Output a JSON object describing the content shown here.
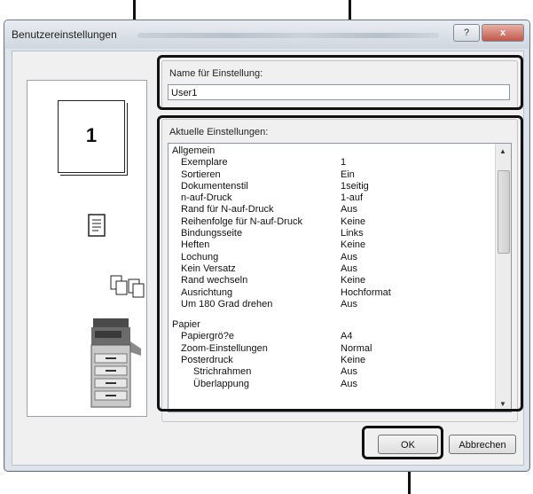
{
  "window": {
    "title": "Benutzereinstellungen"
  },
  "titlebar": {
    "help": "?",
    "close": "x"
  },
  "preview": {
    "page_number": "1"
  },
  "name_group": {
    "label": "Name für Einstellung:",
    "value": "User1"
  },
  "settings_group": {
    "label": "Aktuelle Einstellungen:",
    "rows": [
      {
        "key": "Allgemein",
        "value": "",
        "type": "head"
      },
      {
        "key": "Exemplare",
        "value": "1",
        "type": "item"
      },
      {
        "key": "Sortieren",
        "value": "Ein",
        "type": "item"
      },
      {
        "key": "Dokumentenstil",
        "value": "1seitig",
        "type": "item"
      },
      {
        "key": "n-auf-Druck",
        "value": "1-auf",
        "type": "item"
      },
      {
        "key": "Rand für N-auf-Druck",
        "value": "Aus",
        "type": "item"
      },
      {
        "key": "Reihenfolge für N-auf-Druck",
        "value": "Keine",
        "type": "item"
      },
      {
        "key": "Bindungsseite",
        "value": "Links",
        "type": "item"
      },
      {
        "key": "Heften",
        "value": "Keine",
        "type": "item"
      },
      {
        "key": "Lochung",
        "value": "Aus",
        "type": "item"
      },
      {
        "key": "Kein Versatz",
        "value": "Aus",
        "type": "item"
      },
      {
        "key": "Rand wechseln",
        "value": "Keine",
        "type": "item"
      },
      {
        "key": "Ausrichtung",
        "value": "Hochformat",
        "type": "item"
      },
      {
        "key": "Um 180 Grad drehen",
        "value": "Aus",
        "type": "item"
      },
      {
        "key": "",
        "value": "",
        "type": "gap"
      },
      {
        "key": "Papier",
        "value": "",
        "type": "head"
      },
      {
        "key": "Papiergrö?e",
        "value": "A4",
        "type": "item"
      },
      {
        "key": "Zoom-Einstellungen",
        "value": "Normal",
        "type": "item"
      },
      {
        "key": "Posterdruck",
        "value": "Keine",
        "type": "item"
      },
      {
        "key": "Strichrahmen",
        "value": "Aus",
        "type": "sub"
      },
      {
        "key": "Überlappung",
        "value": "Aus",
        "type": "sub"
      }
    ]
  },
  "buttons": {
    "ok": "OK",
    "cancel": "Abbrechen"
  }
}
